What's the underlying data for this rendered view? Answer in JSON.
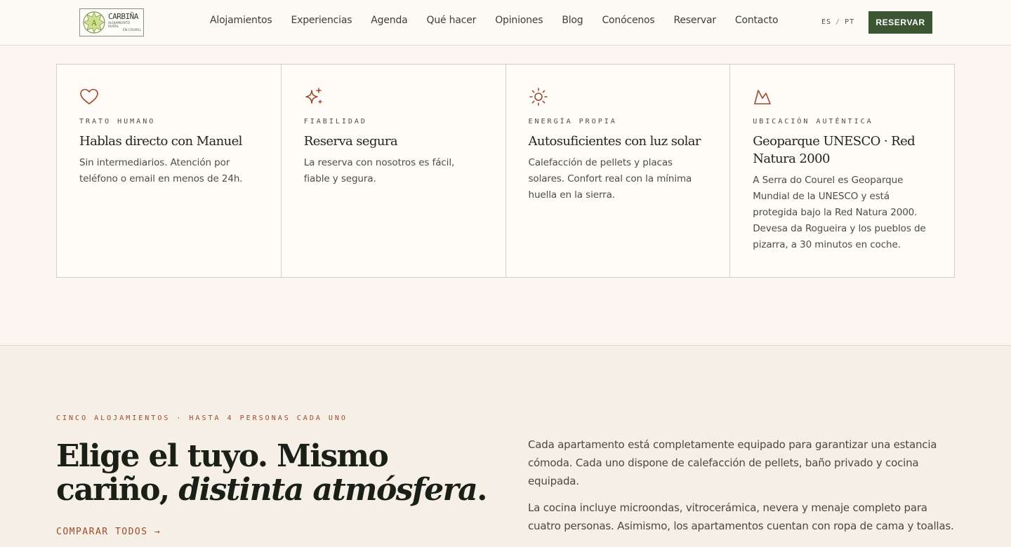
{
  "header": {
    "logo": {
      "name": "CARBIÑA",
      "sub1": "ALOJAMIENTO RURAL",
      "sub2": "EN COUREL"
    },
    "nav": [
      "Alojamientos",
      "Experiencias",
      "Agenda",
      "Qué hacer",
      "Opiniones",
      "Blog",
      "Conócenos",
      "Reservar",
      "Contacto"
    ],
    "lang": {
      "es": "ES",
      "sep": "/",
      "pt": "PT"
    },
    "cta": "RESERVAR"
  },
  "features": [
    {
      "icon": "heart-icon",
      "eyebrow": "TRATO HUMANO",
      "title": "Hablas directo con Manuel",
      "text": "Sin intermediarios. Atención por teléfono o email en menos de 24h."
    },
    {
      "icon": "sparkles-icon",
      "eyebrow": "FIABILIDAD",
      "title": "Reserva segura",
      "text": "La reserva con nosotros es fácil, fiable y segura."
    },
    {
      "icon": "sun-icon",
      "eyebrow": "ENERGÍA PROPIA",
      "title": "Autosuficientes con luz solar",
      "text": "Calefacción de pellets y placas solares. Confort real con la mínima huella en la sierra."
    },
    {
      "icon": "mountain-icon",
      "eyebrow": "UBICACIÓN AUTÉNTICA",
      "title": "Geoparque UNESCO · Red Natura 2000",
      "text": "A Serra do Courel es Geoparque Mundial de la UNESCO y está protegida bajo la Red Natura 2000. Devesa da Rogueira y los pueblos de pizarra, a 30 minutos en coche."
    }
  ],
  "lower": {
    "eyebrow": "CINCO ALOJAMIENTOS · HASTA 4 PERSONAS CADA UNO",
    "headline_a": "Elige el tuyo. Mismo",
    "headline_b": "cariño, ",
    "headline_em": "distinta atmósfera",
    "headline_end": ".",
    "compare": "COMPARAR TODOS →",
    "para1": "Cada apartamento está completamente equipado para garantizar una estancia cómoda. Cada uno dispone de calefacción de pellets, baño privado y cocina equipada.",
    "para2": "La cocina incluye microondas, vitrocerámica, nevera y menaje completo para cuatro personas. Asimismo, los apartamentos cuentan con ropa de cama y toallas."
  },
  "colors": {
    "accent": "#9b4a2d",
    "brand_green": "#3c5634",
    "background": "#fbf6ef"
  }
}
